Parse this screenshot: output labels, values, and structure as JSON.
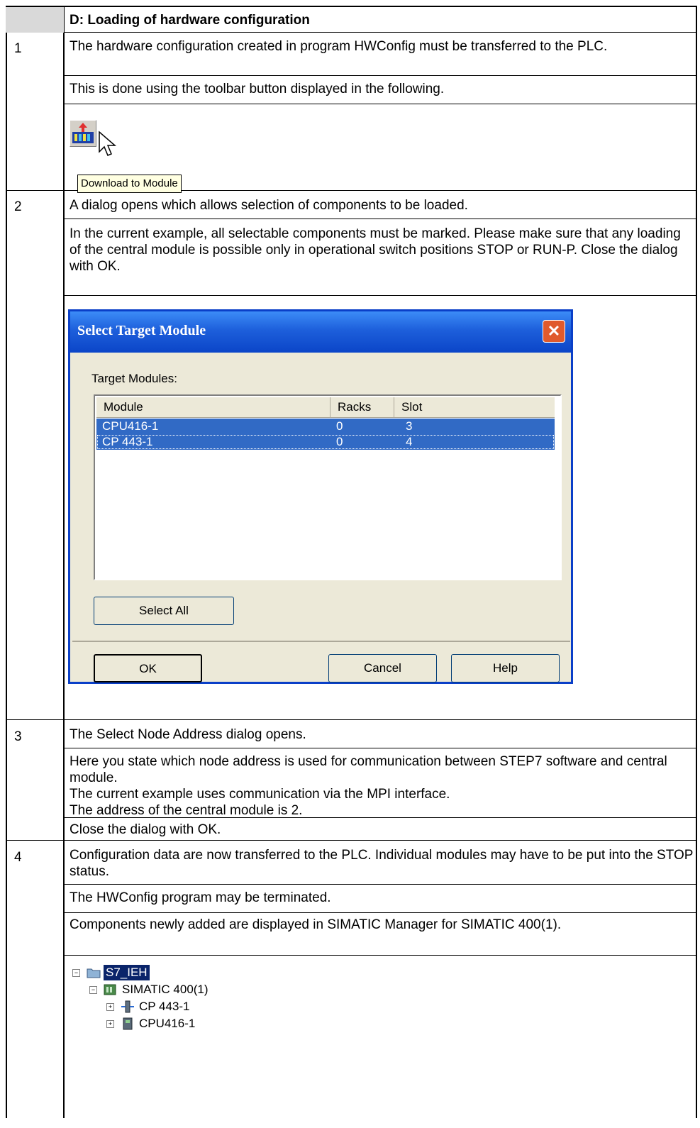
{
  "header": {
    "title": "D: Loading of hardware configuration"
  },
  "steps": [
    {
      "num": "1",
      "paras": [
        "The hardware configuration created in program HWConfig must be transferred to the PLC.",
        "This is done using the toolbar button displayed in the following."
      ]
    },
    {
      "num": "2",
      "paras": [
        "A dialog opens which allows selection of components to be loaded.",
        "In the current example, all selectable components must be marked. Please make sure that any loading of the central module is possible only in operational switch positions STOP or RUN-P. Close the dialog with OK."
      ]
    },
    {
      "num": "3",
      "paras": [
        "The Select Node Address dialog opens.",
        "Here you state which node address is used for communication between STEP7 software and central module.",
        "The current example uses communication via the MPI interface.",
        "The address of the central module is 2.",
        "Close the dialog with OK."
      ]
    },
    {
      "num": "4",
      "paras": [
        "Configuration data are now transferred to the PLC. Individual modules may have to be put into the STOP status.",
        "The HWConfig program may be terminated.",
        "Components newly added are displayed in SIMATIC Manager for SIMATIC 400(1)."
      ]
    }
  ],
  "toolbar": {
    "tooltip": "Download to Module",
    "icon": "download-to-module-icon"
  },
  "dialog": {
    "title": "Select Target Module",
    "close": "✕",
    "label": "Target Modules:",
    "columns": [
      "Module",
      "Racks",
      "Slot"
    ],
    "rows": [
      {
        "module": "CPU416-1",
        "racks": "0",
        "slot": "3"
      },
      {
        "module": "CP 443-1",
        "racks": "0",
        "slot": "4"
      }
    ],
    "select_all": "Select All",
    "ok": "OK",
    "cancel": "Cancel",
    "help": "Help",
    "title_color": "#1d5fdb",
    "selection_color": "#316ac5"
  },
  "tree": {
    "root": "S7_IEH",
    "station": "SIMATIC 400(1)",
    "children": [
      "CP 443-1",
      "CPU416-1"
    ]
  }
}
